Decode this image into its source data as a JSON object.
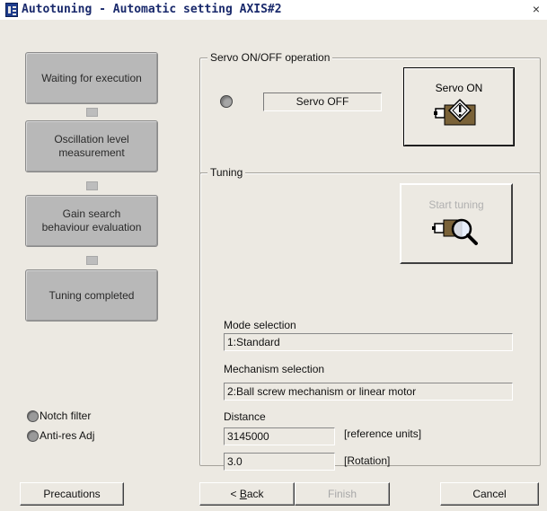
{
  "window": {
    "title": "Autotuning - Automatic setting AXIS#2",
    "close_glyph": "×"
  },
  "steps": [
    {
      "label_line1": "Waiting for execution",
      "label_line2": ""
    },
    {
      "label_line1": "Oscillation level",
      "label_line2": "measurement"
    },
    {
      "label_line1": "Gain search",
      "label_line2": "behaviour evaluation"
    },
    {
      "label_line1": "Tuning completed",
      "label_line2": ""
    }
  ],
  "options": {
    "notch_filter": "Notch filter",
    "anti_res": "Anti-res Adj"
  },
  "servo_group": {
    "title": "Servo ON/OFF operation",
    "status": "Servo OFF",
    "button_label": "Servo ON"
  },
  "tuning_group": {
    "title": "Tuning",
    "start_label": "Start tuning",
    "mode_label": "Mode selection",
    "mode_value": "1:Standard",
    "mechanism_label": "Mechanism selection",
    "mechanism_value": "2:Ball screw mechanism or linear motor",
    "distance_label": "Distance",
    "distance_value": "3145000",
    "distance_unit": "[reference units]",
    "rotation_value": "3.0",
    "rotation_unit": "[Rotation]"
  },
  "footer": {
    "precautions": "Precautions",
    "back_prefix": "< ",
    "back_accel": "B",
    "back_rest": "ack",
    "finish": "Finish",
    "cancel": "Cancel"
  },
  "icons": {
    "servo_on": "servo-motor-power-icon",
    "start_tuning": "motor-magnifier-icon"
  }
}
